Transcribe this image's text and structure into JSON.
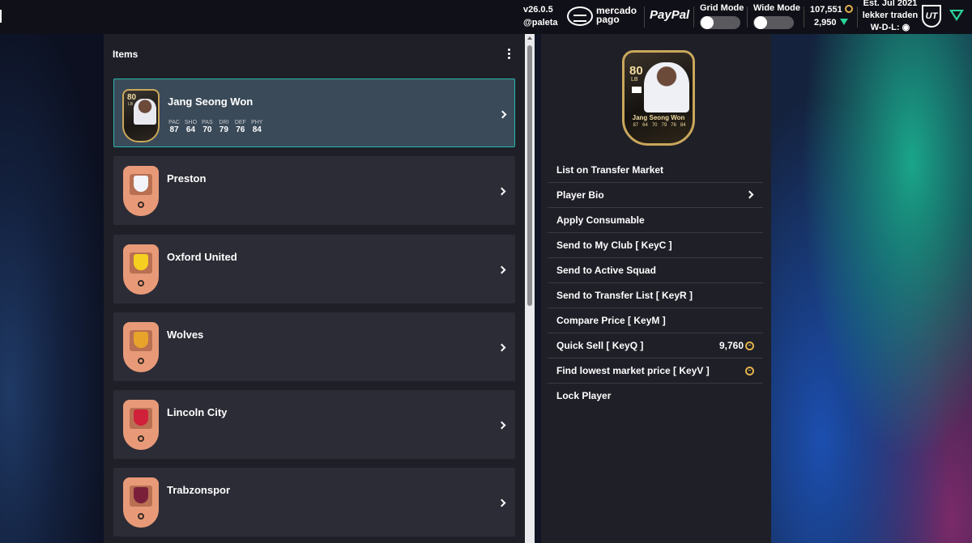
{
  "topbar": {
    "version": "v26.0.5",
    "handle": "@paleta",
    "mercadopago_line1": "mercado",
    "mercadopago_line2": "pago",
    "paypal": "PayPal",
    "grid_mode_label": "Grid Mode",
    "wide_mode_label": "Wide Mode",
    "grid_mode_on": false,
    "wide_mode_on": false,
    "coins": "107,551",
    "points": "2,950",
    "est": "Est. Jul 2021",
    "user": "lekker traden",
    "wdl": "W-D-L:",
    "ut_logo": "UT"
  },
  "items_panel": {
    "title": "Items",
    "items": [
      {
        "name": "Jang Seong Won",
        "type": "player",
        "rating": "80",
        "position": "LB",
        "stats": [
          {
            "label": "PAC",
            "value": "87"
          },
          {
            "label": "SHO",
            "value": "64"
          },
          {
            "label": "PAS",
            "value": "70"
          },
          {
            "label": "DRI",
            "value": "79"
          },
          {
            "label": "DEF",
            "value": "76"
          },
          {
            "label": "PHY",
            "value": "84"
          }
        ]
      },
      {
        "name": "Preston",
        "type": "club",
        "crest_color": "#f2f4fa"
      },
      {
        "name": "Oxford United",
        "type": "club",
        "crest_color": "#f5d020"
      },
      {
        "name": "Wolves",
        "type": "club",
        "crest_color": "#e8a42a"
      },
      {
        "name": "Lincoln City",
        "type": "club",
        "crest_color": "#d0203a"
      },
      {
        "name": "Trabzonspor",
        "type": "club",
        "crest_color": "#7a1f3a"
      }
    ]
  },
  "detail": {
    "card": {
      "rating": "80",
      "position": "LB",
      "name": "Jang Seong Won",
      "stats": [
        "87",
        "64",
        "70",
        "79",
        "76",
        "84"
      ]
    },
    "menu": [
      {
        "label": "List on Transfer Market"
      },
      {
        "label": "Player Bio",
        "chevron": true
      },
      {
        "label": "Apply Consumable"
      },
      {
        "label": "Send to My Club [ KeyC ]"
      },
      {
        "label": "Send to Active Squad"
      },
      {
        "label": "Send to Transfer List [ KeyR ]"
      },
      {
        "label": "Compare Price [ KeyM ]"
      },
      {
        "label": "Quick Sell [ KeyQ ]",
        "price": "9,760",
        "coin": true
      },
      {
        "label": "Find lowest market price [ KeyV ]",
        "coin": true
      },
      {
        "label": "Lock Player"
      }
    ]
  },
  "colors": {
    "accent": "#25b8ab",
    "coin": "#e1b24a",
    "points": "#2ad39a",
    "panel": "#1f1f28",
    "item_bg": "#2c2c36"
  }
}
